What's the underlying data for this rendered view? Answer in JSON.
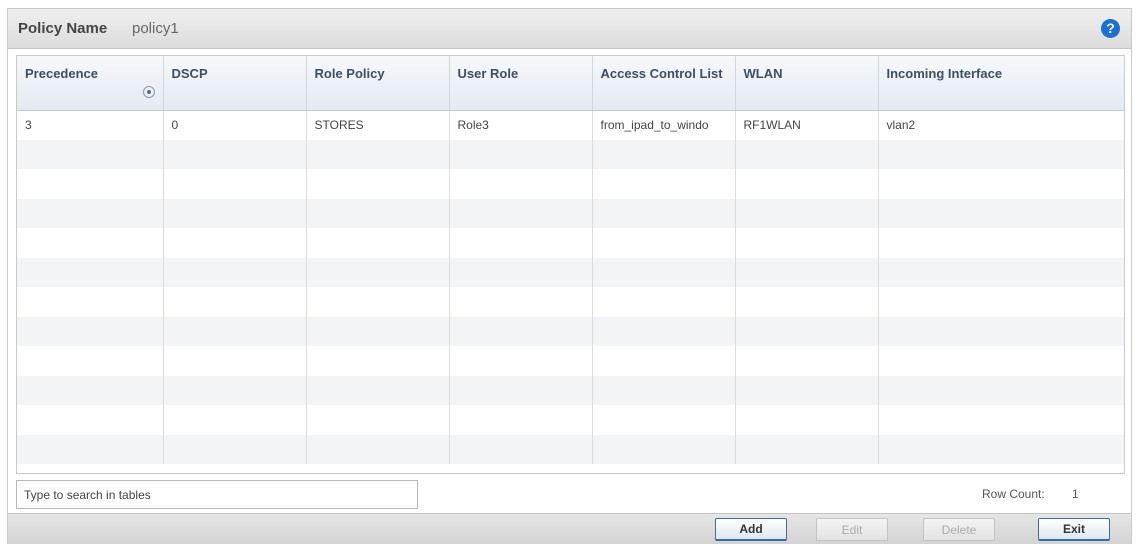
{
  "header": {
    "title_label": "Policy Name",
    "title_value": "policy1",
    "help_symbol": "?"
  },
  "table": {
    "columns": [
      "Precedence",
      "DSCP",
      "Role Policy",
      "User Role",
      "Access Control List",
      "WLAN",
      "Incoming Interface"
    ],
    "rows": [
      [
        "3",
        "0",
        "STORES",
        "Role3",
        "from_ipad_to_windo",
        "RF1WLAN",
        "vlan2"
      ]
    ]
  },
  "search": {
    "placeholder": "Type to search in tables",
    "value": ""
  },
  "row_count": {
    "label": "Row Count:",
    "value": "1"
  },
  "buttons": {
    "add": "Add",
    "edit": "Edit",
    "delete": "Delete",
    "exit": "Exit"
  },
  "colors": {
    "help_icon": "#1a6fd8",
    "header_text": "#3d4f63"
  }
}
